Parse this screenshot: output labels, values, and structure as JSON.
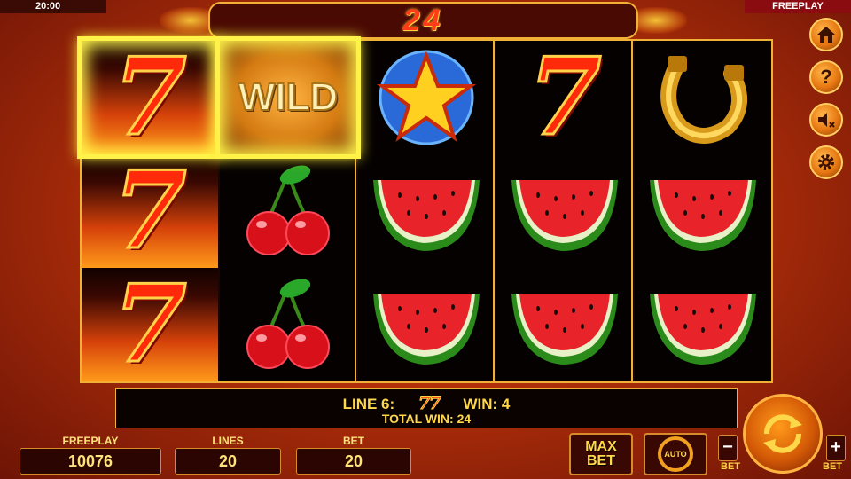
{
  "status": {
    "clock": "20:00",
    "mode": "FREEPLAY"
  },
  "top_win": "24",
  "reels": [
    [
      "seven",
      "seven",
      "seven"
    ],
    [
      "wild",
      "cherry",
      "cherry"
    ],
    [
      "star",
      "watermelon",
      "watermelon"
    ],
    [
      "seven",
      "watermelon",
      "watermelon"
    ],
    [
      "horseshoe",
      "watermelon",
      "watermelon"
    ]
  ],
  "symbols": {
    "seven": "7",
    "wild": "WILD"
  },
  "win_panel": {
    "line_label": "LINE 6:",
    "line_symbols": "77",
    "win_label": "WIN: 4",
    "total_label": "TOTAL WIN: 24"
  },
  "stats": {
    "freeplay_label": "FREEPLAY",
    "freeplay_value": "10076",
    "lines_label": "LINES",
    "lines_value": "20",
    "bet_label": "BET",
    "bet_value": "20"
  },
  "buttons": {
    "max_bet_line1": "MAX",
    "max_bet_line2": "BET",
    "auto": "AUTO",
    "bet_minus": "−",
    "bet_plus": "+",
    "bet_minus_label": "BET",
    "bet_plus_label": "BET"
  },
  "side_icons": [
    "home-icon",
    "help-icon",
    "sound-off-icon",
    "settings-icon"
  ],
  "colors": {
    "frame_gold": "#f1b136",
    "highlight": "#fff34a",
    "win_text": "#ffd84a",
    "seven_red": "#ff2a0a"
  }
}
